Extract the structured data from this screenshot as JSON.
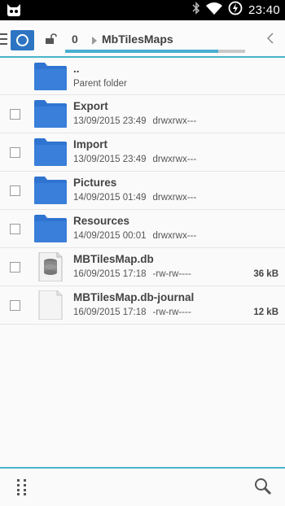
{
  "status_bar": {
    "time": "23:40",
    "icons": [
      "cyanogen-icon",
      "bluetooth-icon",
      "wifi-icon",
      "battery-charging-icon"
    ]
  },
  "toolbar": {
    "selected_count": "0",
    "breadcrumb": "MbTilesMaps",
    "progress": 0.85
  },
  "files": [
    {
      "name": "..",
      "subtitle": "Parent folder",
      "type": "folder",
      "checkbox": false
    },
    {
      "name": "Export",
      "date": "13/09/2015 23:49",
      "perms": "drwxrwx---",
      "size": "",
      "type": "folder",
      "checkbox": true
    },
    {
      "name": "Import",
      "date": "13/09/2015 23:49",
      "perms": "drwxrwx---",
      "size": "",
      "type": "folder",
      "checkbox": true
    },
    {
      "name": "Pictures",
      "date": "14/09/2015 01:49",
      "perms": "drwxrwx---",
      "size": "",
      "type": "folder",
      "checkbox": true
    },
    {
      "name": "Resources",
      "date": "14/09/2015 00:01",
      "perms": "drwxrwx---",
      "size": "",
      "type": "folder",
      "checkbox": true
    },
    {
      "name": "MBTilesMap.db",
      "date": "16/09/2015 17:18",
      "perms": "-rw-rw----",
      "size": "36 kB",
      "type": "database",
      "checkbox": true
    },
    {
      "name": "MBTilesMap.db-journal",
      "date": "16/09/2015 17:18",
      "perms": "-rw-rw----",
      "size": "12 kB",
      "type": "file",
      "checkbox": true
    }
  ],
  "colors": {
    "accent": "#49b3c8",
    "folder": "#2f74d0",
    "home_button": "#2d75c3"
  }
}
